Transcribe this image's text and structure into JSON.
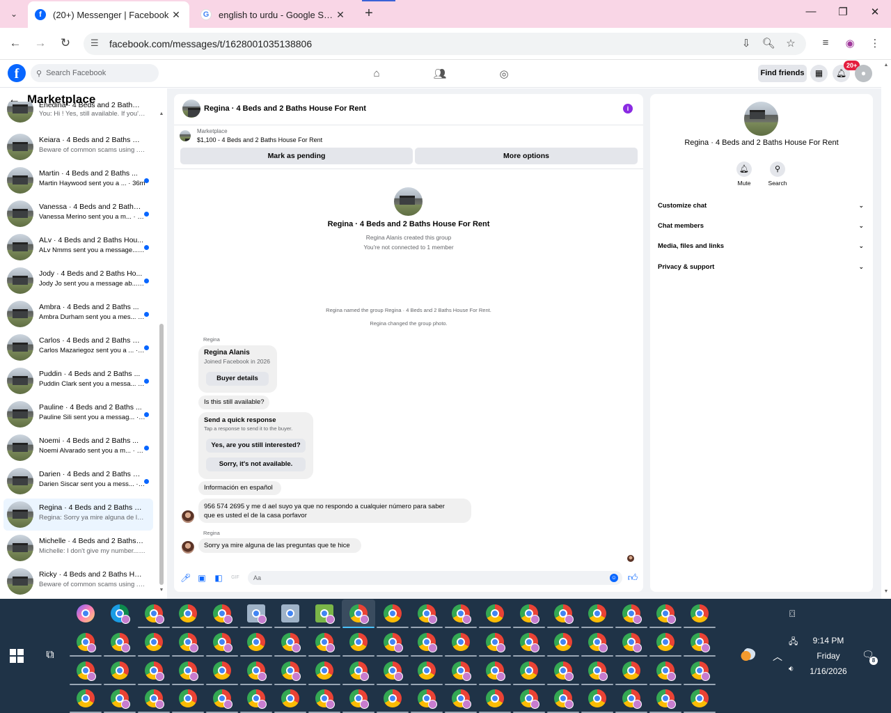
{
  "browser": {
    "tabs": [
      {
        "title": "(20+) Messenger | Facebook",
        "active": true
      },
      {
        "title": "english to urdu - Google Search",
        "active": false
      }
    ],
    "url": "facebook.com/messages/t/1628001035138806"
  },
  "fb": {
    "search_placeholder": "Search Facebook",
    "find_friends": "Find friends",
    "notif_badge": "20+"
  },
  "sidebar": {
    "title": "Marketplace",
    "chats": [
      {
        "name": "Enedina · 4 Beds and 2 Baths H...",
        "preview": "You: Hi ! Yes, still available. If you'... · 1m",
        "unread": false,
        "active": false
      },
      {
        "name": "Keiara · 4 Beds and 2 Baths Ho...",
        "preview": "Beware of common scams using ... · 1m",
        "unread": false,
        "active": false
      },
      {
        "name": "Martin · 4 Beds and 2 Baths ...",
        "preview": "Martin Haywood sent you a ... · 36m",
        "unread": true,
        "active": false
      },
      {
        "name": "Vanessa · 4 Beds and 2 Baths ...",
        "preview": "Vanessa Merino sent you a m... · 55m",
        "unread": true,
        "active": false
      },
      {
        "name": "ALv · 4 Beds and 2 Baths Hou...",
        "preview": "ALv Nmms sent you a message... · 1h",
        "unread": true,
        "active": false
      },
      {
        "name": "Jody · 4 Beds and 2 Baths Ho...",
        "preview": "Jody Jo sent you a message ab... · 2h",
        "unread": true,
        "active": false
      },
      {
        "name": "Ambra · 4 Beds and 2 Baths ...",
        "preview": "Ambra Durham sent you a mes... · 2h",
        "unread": true,
        "active": false
      },
      {
        "name": "Carlos · 4 Beds and 2 Baths H...",
        "preview": "Carlos Mazariegoz sent you a ... · 5h",
        "unread": true,
        "active": false
      },
      {
        "name": "Puddin · 4 Beds and 2 Baths ...",
        "preview": "Puddin Clark sent you a messa... · 8h",
        "unread": true,
        "active": false
      },
      {
        "name": "Pauline · 4 Beds and 2 Baths ...",
        "preview": "Pauline Sili sent you a messag... · 10h",
        "unread": true,
        "active": false
      },
      {
        "name": "Noemi · 4 Beds and 2 Baths ...",
        "preview": "Noemi Alvarado sent you a m... · 10h",
        "unread": true,
        "active": false
      },
      {
        "name": "Darien · 4 Beds and 2 Baths H...",
        "preview": "Darien Siscar sent you a mess... · 12h",
        "unread": true,
        "active": false
      },
      {
        "name": "Regina · 4 Beds and 2 Baths Ho...",
        "preview": "Regina: Sorry ya mire alguna de l... · 12h",
        "unread": false,
        "active": true
      },
      {
        "name": "Michelle · 4 Beds and 2 Baths ...",
        "preview": "Michelle: I don't give my number... · 20h",
        "unread": false,
        "active": false
      },
      {
        "name": "Ricky · 4 Beds and 2 Baths Hou...",
        "preview": "Beware of common scams using ... · 20h",
        "unread": false,
        "active": false
      }
    ]
  },
  "conversation": {
    "title": "Regina · 4 Beds and 2 Baths House For Rent",
    "marketplace_label": "Marketplace",
    "listing": "$1,100 - 4 Beds and 2 Baths House For Rent",
    "mark_pending": "Mark as pending",
    "more_options": "More options",
    "group_name": "Regina · 4 Beds and 2 Baths House For Rent",
    "created_by": "Regina Alanis created this group",
    "connection": "You're not connected to 1 member",
    "sys1": "Regina named the group Regina · 4 Beds and 2 Baths House For Rent.",
    "sys2": "Regina changed the group photo.",
    "sender1": "Regina",
    "buyer_name": "Regina Alanis",
    "buyer_joined": "Joined Facebook in 2026",
    "buyer_details": "Buyer details",
    "msg_available": "Is this still available?",
    "quick_title": "Send a quick response",
    "quick_sub": "Tap a response to send it to the buyer.",
    "quick_a": "Yes, are you still interested?",
    "quick_b": "Sorry, it's not available.",
    "spanish": "Información en español",
    "msg_phone_1": "956 574 2695  y me d ael suyo ya que no respondo a cualquier número para saber",
    "msg_phone_2": "que es usted el de la casa porfavor",
    "sender2": "Regina",
    "msg_sorry": "Sorry ya mire alguna de las preguntas que te hice",
    "composer_placeholder": "Aa"
  },
  "info_panel": {
    "name": "Regina · 4 Beds and 2 Baths House For Rent",
    "mute": "Mute",
    "search": "Search",
    "sections": [
      "Customize chat",
      "Chat members",
      "Media, files and links",
      "Privacy & support"
    ]
  },
  "taskbar": {
    "time": "9:14 PM",
    "day": "Friday",
    "date": "1/16/2026",
    "notifications": "8"
  },
  "colors": {
    "accent": "#0866ff",
    "tabstrip": "#f9d6e6",
    "taskbar": "#1f3347"
  }
}
